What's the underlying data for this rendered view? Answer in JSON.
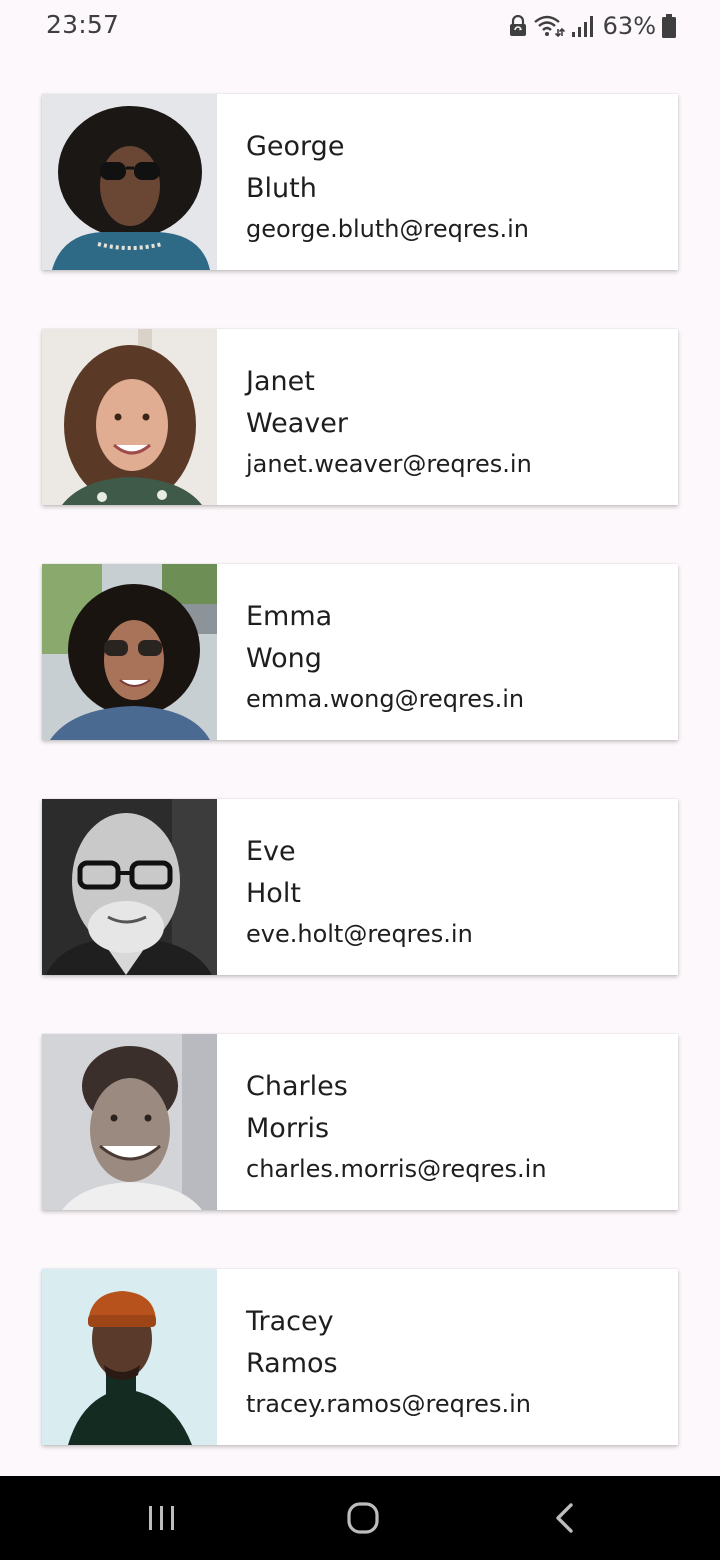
{
  "status_bar": {
    "time": "23:57",
    "battery_percent": "63%",
    "icons": [
      "lock-sync-icon",
      "wifi-icon",
      "signal-icon",
      "battery-icon"
    ]
  },
  "users": [
    {
      "first_name": "George",
      "last_name": "Bluth",
      "email": "george.bluth@reqres.in"
    },
    {
      "first_name": "Janet",
      "last_name": "Weaver",
      "email": "janet.weaver@reqres.in"
    },
    {
      "first_name": "Emma",
      "last_name": "Wong",
      "email": "emma.wong@reqres.in"
    },
    {
      "first_name": "Eve",
      "last_name": "Holt",
      "email": "eve.holt@reqres.in"
    },
    {
      "first_name": "Charles",
      "last_name": "Morris",
      "email": "charles.morris@reqres.in"
    },
    {
      "first_name": "Tracey",
      "last_name": "Ramos",
      "email": "tracey.ramos@reqres.in"
    }
  ],
  "nav_bar": {
    "icons": [
      "recent-apps-icon",
      "home-icon",
      "back-icon"
    ]
  },
  "colors": {
    "background": "#fcf8fb",
    "card": "#ffffff",
    "text": "#1e1e1e",
    "nav_bar": "#000000"
  }
}
